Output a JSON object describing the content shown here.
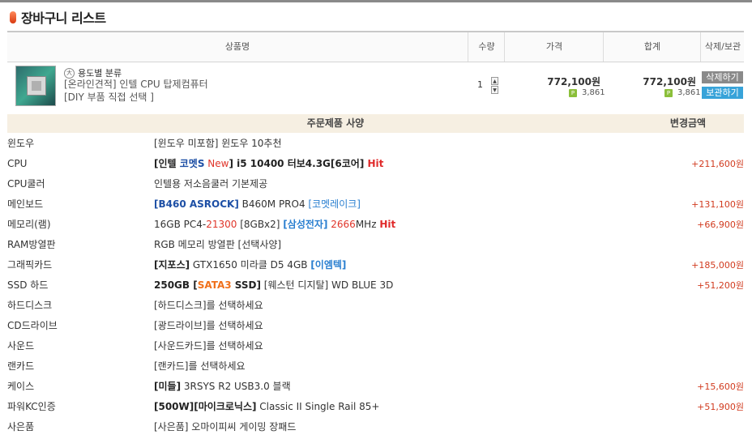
{
  "page_title": "장바구니 리스트",
  "table_header": {
    "product": "상품명",
    "quantity": "수량",
    "price": "가격",
    "total": "합계",
    "actions": "삭제/보관함"
  },
  "product": {
    "category": "용도별 분류",
    "name_line1": "[온라인견적] 인텔 CPU 탑제컴퓨터",
    "name_line2": "[DIY 부품 직접 선택 ]",
    "quantity": "1",
    "price": "772,100원",
    "price_points": "3,861",
    "total": "772,100원",
    "total_points": "3,861",
    "delete_label": "삭제하기",
    "keep_label": "보관하기"
  },
  "spec_header": {
    "spec": "주문제품 사양",
    "change": "변경금액"
  },
  "specs": {
    "os": {
      "label": "윈도우",
      "a": "[윈도우 미포함] 윈도우 10추천",
      "amount": ""
    },
    "cpu": {
      "label": "CPU",
      "a": "[인텔 ",
      "b": "코멧S",
      "c": " New",
      "d": "] i5 10400 터보4.3G[6코어] ",
      "e": "Hit",
      "amount": "+211,600원"
    },
    "cooler": {
      "label": "CPU쿨러",
      "a": "인텔용 저소음쿨러 기본제공",
      "amount": ""
    },
    "mainboard": {
      "label": "메인보드",
      "a": "[B460 ASROCK]",
      "b": " B460M PRO4 ",
      "c": "[코멧레이크]",
      "amount": "+131,100원"
    },
    "memory": {
      "label": "메모리(램)",
      "a": "16GB PC4-",
      "b": "21300",
      "c": " [8GBx2] ",
      "d": "[삼성전자]",
      "e": " ",
      "f": "2666",
      "g": "MHz ",
      "h": "Hit",
      "amount": "+66,900원"
    },
    "ramheat": {
      "label": "RAM방열판",
      "a": "RGB 메모리 방열판 [선택사양]",
      "amount": ""
    },
    "gpu": {
      "label": "그래픽카드",
      "a": "[지포스]",
      "b": " GTX1650 미라클 D5 4GB ",
      "c": "[이엠텍]",
      "amount": "+185,000원"
    },
    "ssd": {
      "label": "SSD 하드",
      "a": "250GB ",
      "b": "[",
      "c": "SATA3",
      "d": " SSD]",
      "e": " [웨스턴 디지탈] WD BLUE 3D",
      "amount": "+51,200원"
    },
    "hdd": {
      "label": "하드디스크",
      "a": "[하드디스크]를 선택하세요",
      "amount": ""
    },
    "odd": {
      "label": "CD드라이브",
      "a": "[광드라이브]를 선택하세요",
      "amount": ""
    },
    "sound": {
      "label": "사운드",
      "a": "[사운드카드]를 선택하세요",
      "amount": ""
    },
    "lan": {
      "label": "랜카드",
      "a": "[랜카드]를 선택하세요",
      "amount": ""
    },
    "case": {
      "label": "케이스",
      "a": "[미들]",
      "b": " 3RSYS R2 USB3.0 블랙",
      "amount": "+15,600원"
    },
    "psu": {
      "label": "파워KC인증",
      "a": "[500W][마이크로닉스]",
      "b": " Classic II Single Rail 85+",
      "amount": "+51,900원"
    },
    "gift": {
      "label": "사은품",
      "a": "[사은품] 오마이피씨 게이밍 장패드",
      "amount": ""
    }
  },
  "colors": {
    "accent_red": "#d13b1f",
    "keep_blue": "#38a3d9",
    "delete_gray": "#8a8a8a",
    "spec_header_bg": "#f6efe2"
  },
  "icons": [
    "cart-bullet-icon",
    "category-icon",
    "point-icon",
    "quantity-up-icon",
    "quantity-down-icon"
  ]
}
